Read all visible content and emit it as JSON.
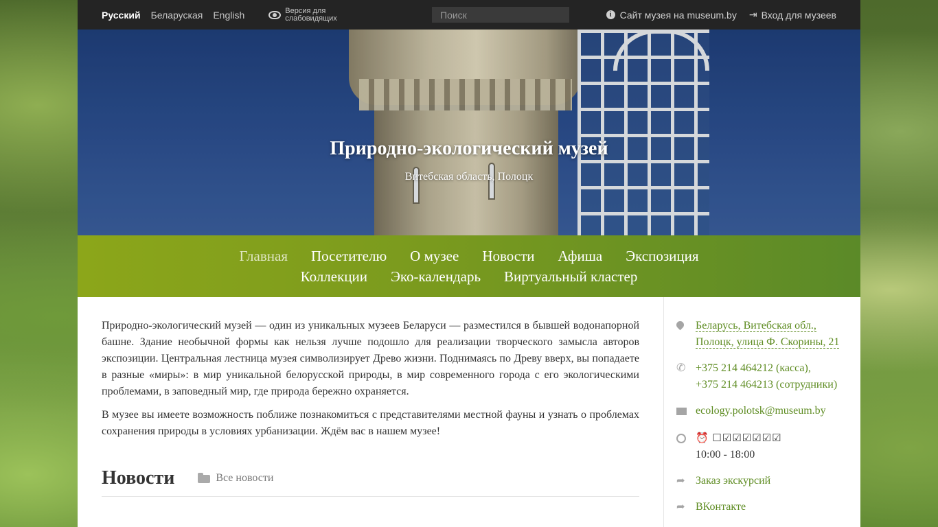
{
  "topbar": {
    "languages": [
      {
        "label": "Русский",
        "active": true
      },
      {
        "label": "Беларуская",
        "active": false
      },
      {
        "label": "English",
        "active": false
      }
    ],
    "a11y_label": "Версия для слабовидящих",
    "search_placeholder": "Поиск",
    "museum_site_link": "Сайт музея на museum.by",
    "login_link": "Вход для музеев"
  },
  "hero": {
    "title": "Природно-экологический музей",
    "subtitle": "Витебская область, Полоцк"
  },
  "nav": {
    "items": [
      {
        "label": "Главная",
        "active": true
      },
      {
        "label": "Посетителю",
        "active": false
      },
      {
        "label": "О музее",
        "active": false
      },
      {
        "label": "Новости",
        "active": false
      },
      {
        "label": "Афиша",
        "active": false
      },
      {
        "label": "Экспозиция",
        "active": false
      },
      {
        "label": "Коллекции",
        "active": false
      },
      {
        "label": "Эко-календарь",
        "active": false
      },
      {
        "label": "Виртуальный кластер",
        "active": false
      }
    ]
  },
  "main": {
    "paragraphs": [
      "Природно-экологический музей — один из уникальных музеев Беларуси — разместился в бывшей водонапорной башне. Здание необычной формы как нельзя лучше подошло для реализации творческого замысла авторов экспозиции. Центральная лестница музея символизирует Древо жизни. Поднимаясь по Древу вверх, вы попадаете в разные «миры»: в мир уникальной белорусской природы, в мир современного города с его экологическими проблемами, в заповедный мир, где природа бережно охраняется.",
      "В музее вы имеете возможность поближе познакомиться с представителями местной фауны и узнать о проблемах сохранения природы в условиях урбанизации. Ждём вас в нашем музее!"
    ],
    "news_title": "Новости",
    "all_news": "Все новости"
  },
  "sidebar": {
    "address_line1": "Беларусь, Витебская обл.,",
    "address_line2": "Полоцк, улица Ф. Скорины, 21",
    "phone1": "+375 214 464212 (касса),",
    "phone2": "+375 214 464213 (сотрудники)",
    "email": "ecology.polotsk@museum.by",
    "hours_days": "⏰ ☐☑☑☑☑☑☑",
    "hours_time": "10:00 - 18:00",
    "excursions": "Заказ экскурсий",
    "vk": "ВКонтакте"
  },
  "colors": {
    "topbar": "#242424",
    "nav_start": "#8ca61a",
    "nav_end": "#5b8a28",
    "link": "#5e8c22"
  }
}
